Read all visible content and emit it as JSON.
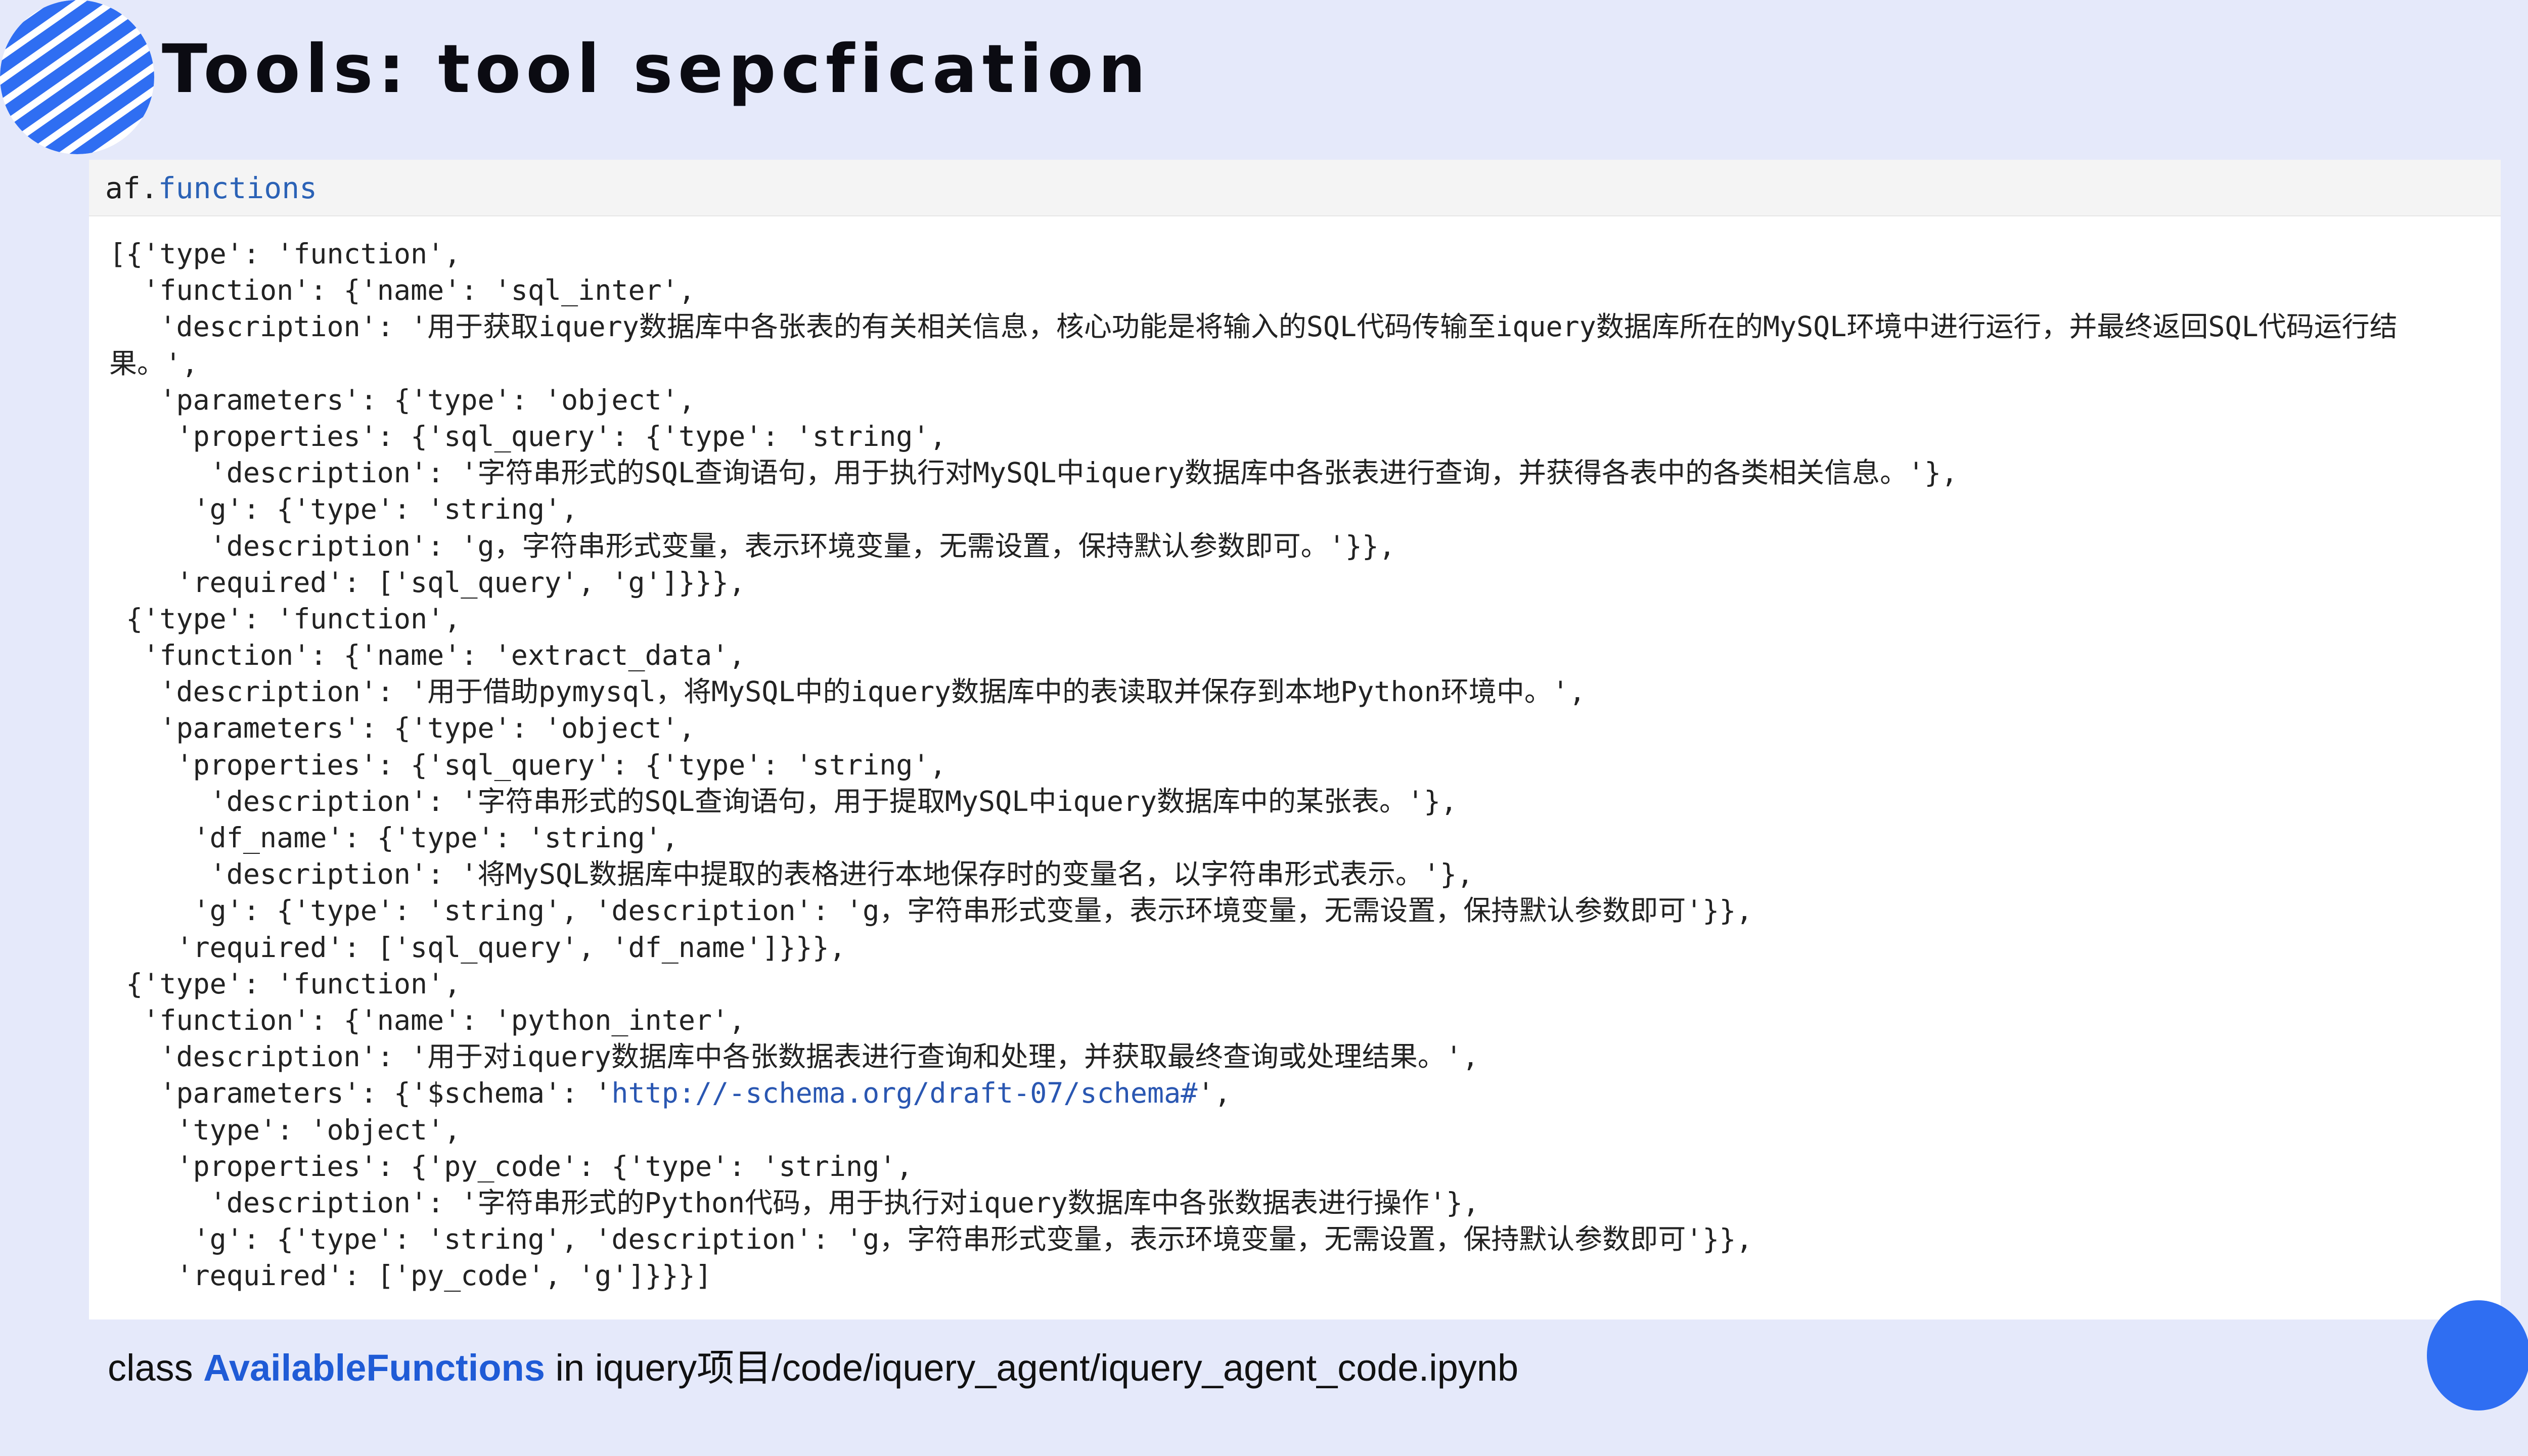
{
  "slide": {
    "title": "Tools: tool sepcfication",
    "accent_color": "#2f6ef2",
    "background_color": "#e5e9fa"
  },
  "notebook": {
    "input_object": "af",
    "input_separator": ".",
    "input_attribute": "functions",
    "output_lines": [
      "[{'type': 'function',",
      "  'function': {'name': 'sql_inter',",
      "   'description': '用于获取iquery数据库中各张表的有关相关信息，核心功能是将输入的SQL代码传输至iquery数据库所在的MySQL环境中进行运行，并最终返回SQL代码运行结",
      "果。',",
      "   'parameters': {'type': 'object',",
      "    'properties': {'sql_query': {'type': 'string',",
      "      'description': '字符串形式的SQL查询语句，用于执行对MySQL中iquery数据库中各张表进行查询，并获得各表中的各类相关信息。'},",
      "     'g': {'type': 'string',",
      "      'description': 'g，字符串形式变量，表示环境变量，无需设置，保持默认参数即可。'}},",
      "    'required': ['sql_query', 'g']}}},",
      " {'type': 'function',",
      "  'function': {'name': 'extract_data',",
      "   'description': '用于借助pymysql，将MySQL中的iquery数据库中的表读取并保存到本地Python环境中。',",
      "   'parameters': {'type': 'object',",
      "    'properties': {'sql_query': {'type': 'string',",
      "      'description': '字符串形式的SQL查询语句，用于提取MySQL中iquery数据库中的某张表。'},",
      "     'df_name': {'type': 'string',",
      "      'description': '将MySQL数据库中提取的表格进行本地保存时的变量名，以字符串形式表示。'},",
      "     'g': {'type': 'string', 'description': 'g，字符串形式变量，表示环境变量，无需设置，保持默认参数即可'}},",
      "    'required': ['sql_query', 'df_name']}}},",
      " {'type': 'function',",
      "  'function': {'name': 'python_inter',",
      "   'description': '用于对iquery数据库中各张数据表进行查询和处理，并获取最终查询或处理结果。',",
      "   'parameters': {'$schema': '",
      "    'type': 'object',",
      "    'properties': {'py_code': {'type': 'string',",
      "      'description': '字符串形式的Python代码，用于执行对iquery数据库中各张数据表进行操作'},",
      "     'g': {'type': 'string', 'description': 'g，字符串形式变量，表示环境变量，无需设置，保持默认参数即可'}},",
      "    'required': ['py_code', 'g']}}}]"
    ],
    "schema_link": "http://-schema.org/draft-07/schema#",
    "schema_line_suffix": "',"
  },
  "caption": {
    "prefix": "class ",
    "class_name": "AvailableFunctions",
    "suffix": " in iquery项目/code/iquery_agent/iquery_agent_code.ipynb"
  }
}
